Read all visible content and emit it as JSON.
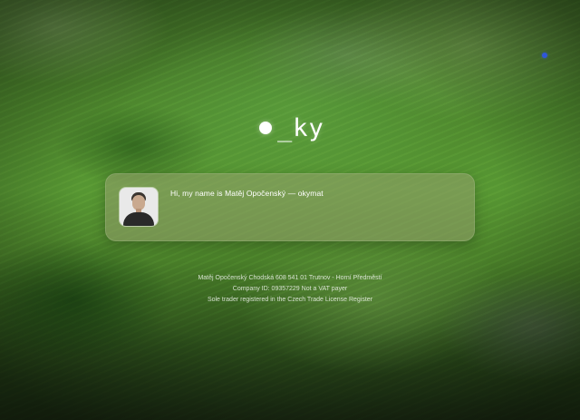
{
  "logo": {
    "text": "_ky",
    "dot_icon": "circle-dot-icon"
  },
  "intro_card": {
    "message": "Hi, my name is Matěj Opočenský — okymat",
    "avatar_icon": "profile-photo"
  },
  "footer": {
    "line1": "Matěj Opočenský Chodská 608 541 01 Trutnov - Horní Předměstí",
    "line2": "Company ID: 09357229 Not a VAT payer",
    "line3": "Sole trader registered in the Czech Trade License Register"
  },
  "colors": {
    "card_background": "#96a06e",
    "text": "#ffffff",
    "accent_dot": "#2f56d8"
  }
}
